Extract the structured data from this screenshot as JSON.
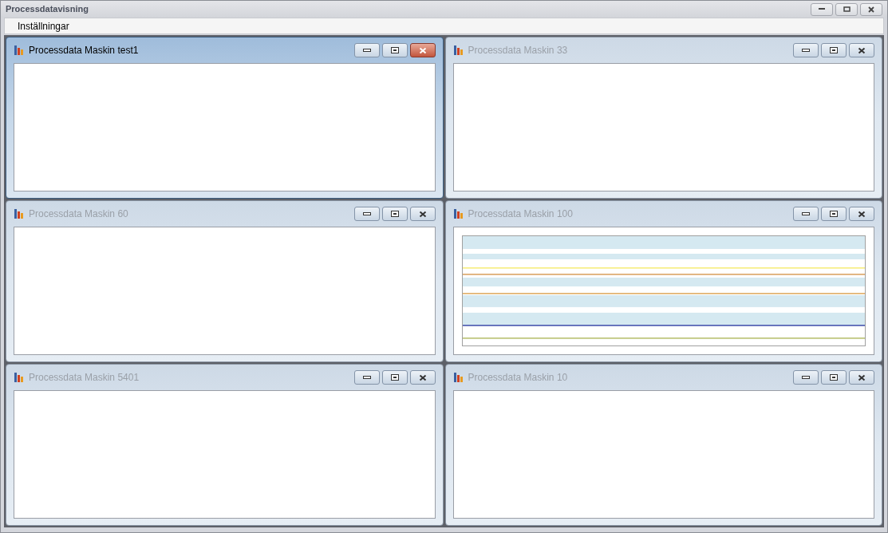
{
  "window": {
    "title": "Processdatavisning"
  },
  "menu": [
    {
      "label": "Inställningar"
    }
  ],
  "child_windows": [
    {
      "title": "Processdata Maskin test1",
      "selected": true,
      "kind": "empty"
    },
    {
      "title": "Processdata Maskin 33",
      "selected": false,
      "kind": "empty"
    },
    {
      "title": "Processdata Maskin 60",
      "selected": false,
      "kind": "empty"
    },
    {
      "title": "Processdata Maskin 100",
      "selected": false,
      "kind": "chart"
    },
    {
      "title": "Processdata Maskin 5401",
      "selected": false,
      "kind": "empty"
    },
    {
      "title": "Processdata Maskin 10",
      "selected": false,
      "kind": "empty"
    }
  ]
}
